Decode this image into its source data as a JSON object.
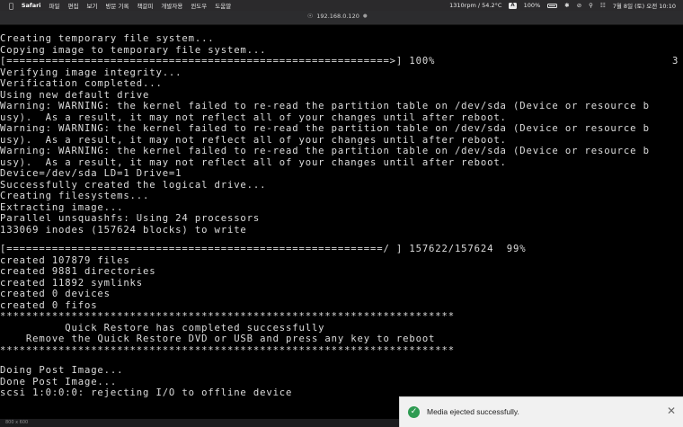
{
  "menubar": {
    "app_name": "Safari",
    "items": [
      "파일",
      "편집",
      "보기",
      "방문 기록",
      "책갈피",
      "개발자용",
      "윈도우",
      "도움말"
    ],
    "fan_status": "1310rpm / 54.2°C",
    "input_badge": "A",
    "battery": "100%",
    "datetime": "7월 8일 (토) 오전 10:10"
  },
  "browser": {
    "url": "192.168.0.120"
  },
  "console": {
    "lines": [
      "Creating temporary file system...",
      "Copying image to temporary file system...",
      "[===========================================================>] 100%",
      "Verifying image integrity...",
      "Verification completed...",
      "Using new default drive",
      "Warning: WARNING: the kernel failed to re-read the partition table on /dev/sda (Device or resource b",
      "usy).  As a result, it may not reflect all of your changes until after reboot.",
      "Warning: WARNING: the kernel failed to re-read the partition table on /dev/sda (Device or resource b",
      "usy).  As a result, it may not reflect all of your changes until after reboot.",
      "Warning: WARNING: the kernel failed to re-read the partition table on /dev/sda (Device or resource b",
      "usy).  As a result, it may not reflect all of your changes until after reboot.",
      "Device=/dev/sda LD=1 Drive=1",
      "Successfully created the logical drive...",
      "Creating filesystems...",
      "Extracting image...",
      "Parallel unsquashfs: Using 24 processors",
      "133069 inodes (157624 blocks) to write",
      "",
      "[==========================================================/ ] 157622/157624  99%",
      "created 107879 files",
      "created 9881 directories",
      "created 11892 symlinks",
      "created 0 devices",
      "created 0 fifos",
      "**********************************************************************",
      "          Quick Restore has completed successfully",
      "    Remove the Quick Restore DVD or USB and press any key to reboot",
      "**********************************************************************",
      "",
      "Doing Post Image...",
      "Done Post Image...",
      "scsi 1:0:0:0: rejecting I/O to offline device"
    ],
    "trailing_number": "3"
  },
  "footer": {
    "resolution": "800 x 600"
  },
  "toast": {
    "message": "Media ejected successfully."
  },
  "colors": {
    "terminal_bg": "#000000",
    "terminal_text": "#dcdcdc",
    "toast_success": "#2e9b52"
  }
}
